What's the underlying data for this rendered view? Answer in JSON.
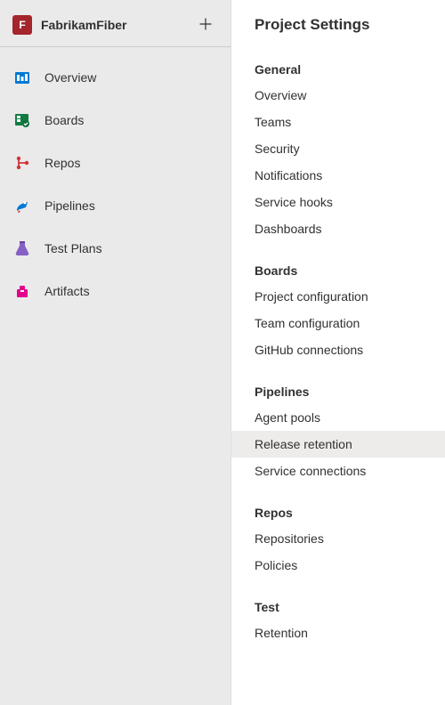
{
  "sidebar": {
    "project_avatar_letter": "F",
    "project_name": "FabrikamFiber",
    "items": [
      {
        "label": "Overview",
        "icon": "overview-icon"
      },
      {
        "label": "Boards",
        "icon": "boards-icon"
      },
      {
        "label": "Repos",
        "icon": "repos-icon"
      },
      {
        "label": "Pipelines",
        "icon": "pipelines-icon"
      },
      {
        "label": "Test Plans",
        "icon": "testplans-icon"
      },
      {
        "label": "Artifacts",
        "icon": "artifacts-icon"
      }
    ]
  },
  "settings": {
    "title": "Project Settings",
    "sections": [
      {
        "header": "General",
        "items": [
          "Overview",
          "Teams",
          "Security",
          "Notifications",
          "Service hooks",
          "Dashboards"
        ]
      },
      {
        "header": "Boards",
        "items": [
          "Project configuration",
          "Team configuration",
          "GitHub connections"
        ]
      },
      {
        "header": "Pipelines",
        "items": [
          "Agent pools",
          "Release retention",
          "Service connections"
        ],
        "active_index": 1
      },
      {
        "header": "Repos",
        "items": [
          "Repositories",
          "Policies"
        ]
      },
      {
        "header": "Test",
        "items": [
          "Retention"
        ]
      }
    ]
  }
}
